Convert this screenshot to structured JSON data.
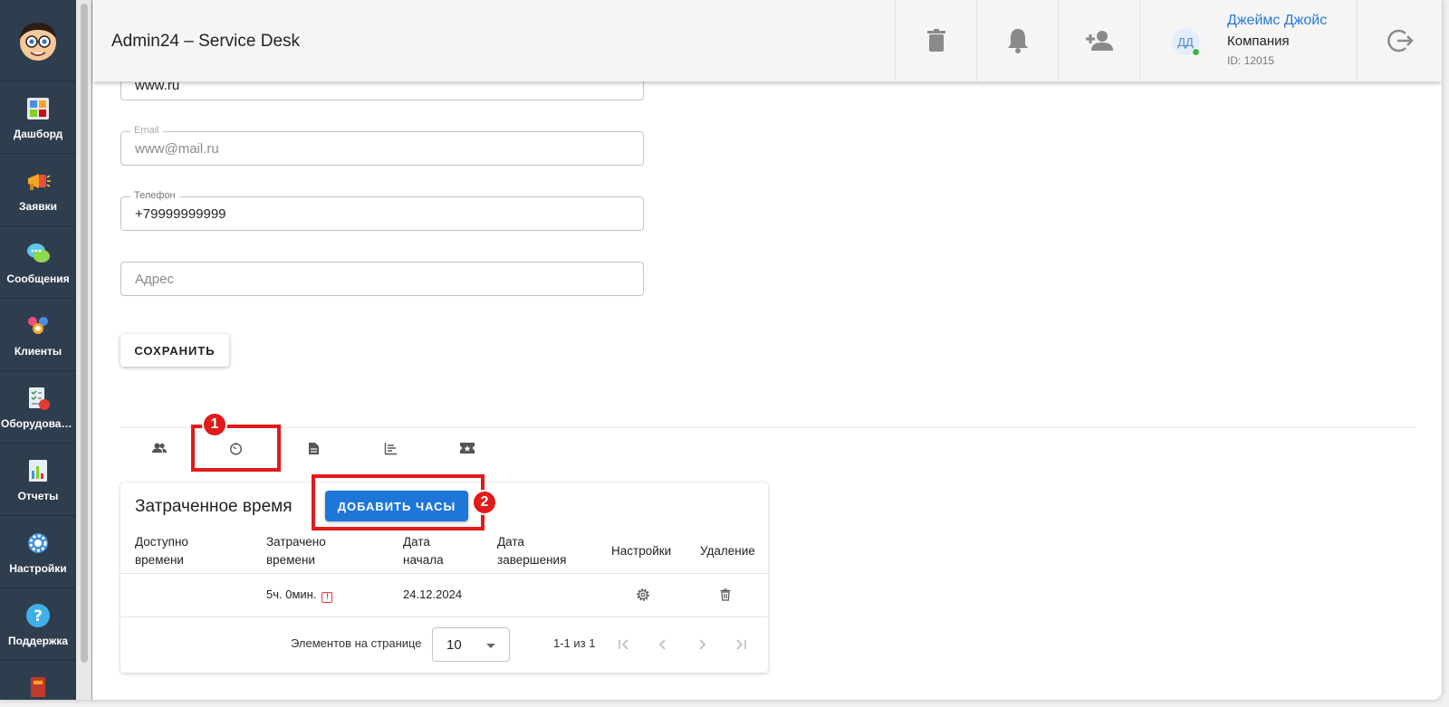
{
  "sidebar": {
    "items": [
      {
        "label": "Дашборд"
      },
      {
        "label": "Заявки"
      },
      {
        "label": "Сообщения"
      },
      {
        "label": "Клиенты"
      },
      {
        "label": "Оборудован..."
      },
      {
        "label": "Отчеты"
      },
      {
        "label": "Настройки"
      },
      {
        "label": "Поддержка"
      }
    ]
  },
  "header": {
    "title": "Admin24 – Service Desk",
    "user": {
      "initials": "ДД",
      "name": "Джеймс Джойс",
      "company": "Компания",
      "id": "ID: 12015"
    }
  },
  "form": {
    "website_value": "www.ru",
    "email_label": "Email",
    "email_value": "www@mail.ru",
    "phone_label": "Телефон",
    "phone_value": "+79999999999",
    "address_placeholder": "Адрес",
    "save_label": "СОХРАНИТЬ"
  },
  "annotations": {
    "badge1": "1",
    "badge2": "2"
  },
  "time_card": {
    "title": "Затраченное время",
    "add_label": "ДОБАВИТЬ ЧАСЫ",
    "columns": {
      "available_1": "Доступно",
      "available_2": "времени",
      "spent_1": "Затрачено",
      "spent_2": "времени",
      "start_1": "Дата",
      "start_2": "начала",
      "end_1": "Дата",
      "end_2": "завершения",
      "settings": "Настройки",
      "delete": "Удаление"
    },
    "rows": [
      {
        "available": "",
        "spent": "5ч. 0мин.",
        "start": "24.12.2024",
        "end": ""
      }
    ],
    "pagination": {
      "per_page_label": "Элементов на странице",
      "per_page_value": "10",
      "range": "1-1 из 1"
    }
  },
  "colors": {
    "sidebar": "#2f3e4e",
    "accent": "#1e76d8",
    "highlight": "#e11a1a",
    "online": "#3bb54a"
  }
}
